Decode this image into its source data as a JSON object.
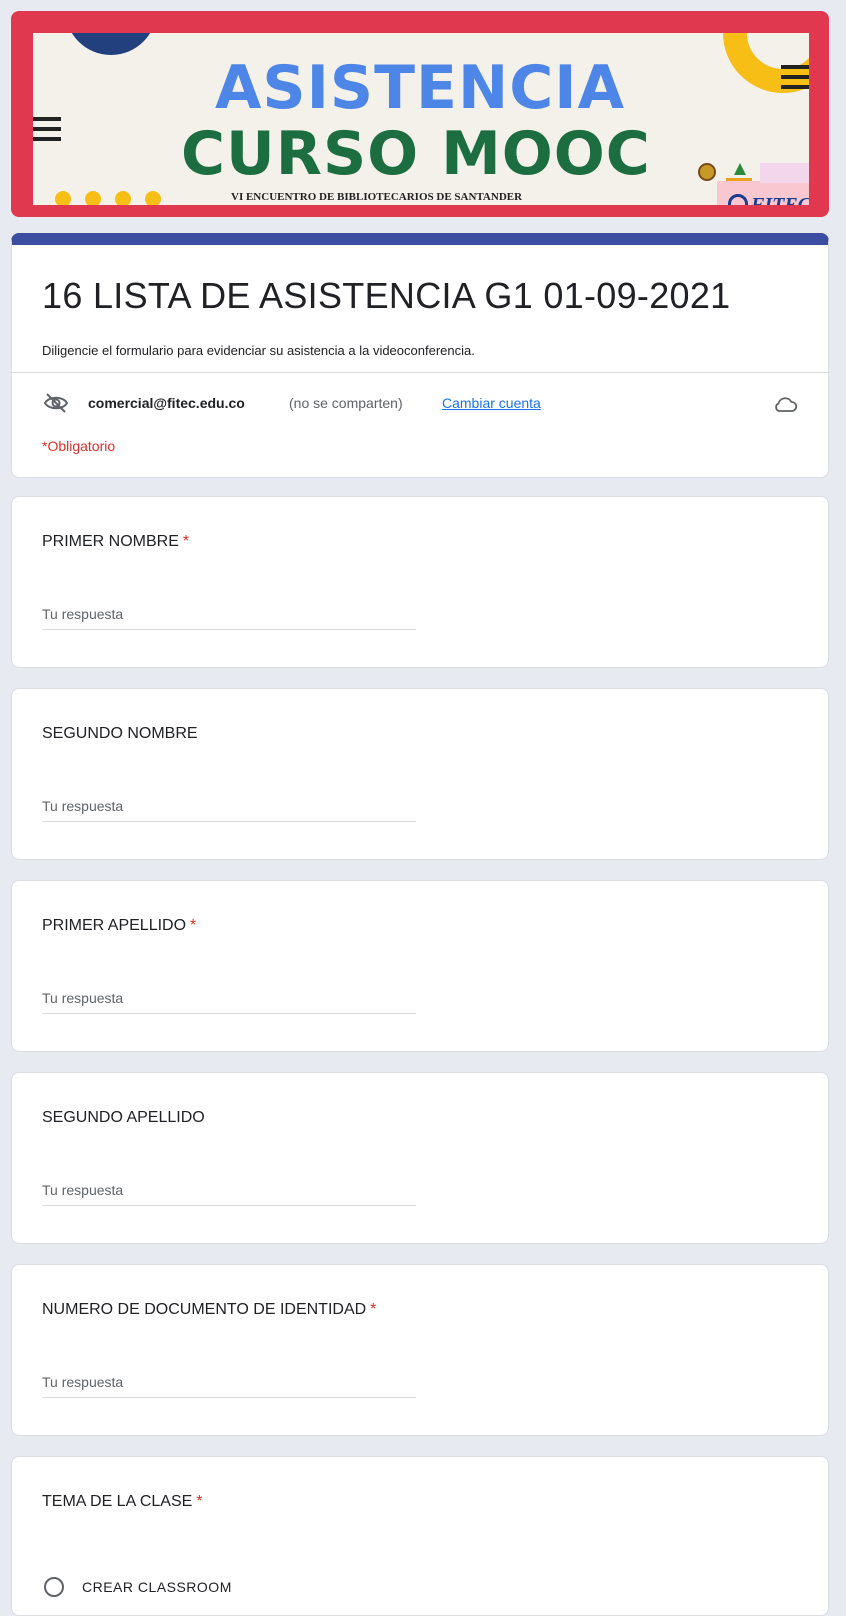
{
  "banner": {
    "title_line1": "ASISTENCIA",
    "title_line2": "CURSO MOOC",
    "subtitle": "VI ENCUENTRO DE BIBLIOTECARIOS DE SANTANDER",
    "logo_text": "FITEC",
    "colors": {
      "frame": "#e0394f",
      "title1": "#4e86e8",
      "title2": "#1c6e41",
      "accent_yellow": "#f7be16",
      "accent_navy": "#23407e"
    }
  },
  "header": {
    "title": "16 LISTA DE ASISTENCIA G1 01-09-2021",
    "description": "Diligencie el formulario para evidenciar su asistencia a la videoconferencia.",
    "account_email": "comercial@fitec.edu.co",
    "account_note": "(no se comparten)",
    "switch_account": "Cambiar cuenta",
    "required_note": "*Obligatorio",
    "accent_color": "#3c4ea0",
    "icons": {
      "privacy": "eye-slash-icon",
      "save_status": "cloud-icon"
    }
  },
  "questions": [
    {
      "label": "PRIMER NOMBRE",
      "required": "*",
      "placeholder": "Tu respuesta"
    },
    {
      "label": "SEGUNDO NOMBRE",
      "required": "",
      "placeholder": "Tu respuesta"
    },
    {
      "label": "PRIMER APELLIDO",
      "required": "*",
      "placeholder": "Tu respuesta"
    },
    {
      "label": "SEGUNDO APELLIDO",
      "required": "",
      "placeholder": "Tu respuesta"
    },
    {
      "label": "NUMERO DE DOCUMENTO DE IDENTIDAD",
      "required": "*",
      "placeholder": "Tu respuesta"
    },
    {
      "label": "TEMA DE LA CLASE",
      "required": "*",
      "options": [
        "CREAR CLASSROOM"
      ]
    }
  ]
}
